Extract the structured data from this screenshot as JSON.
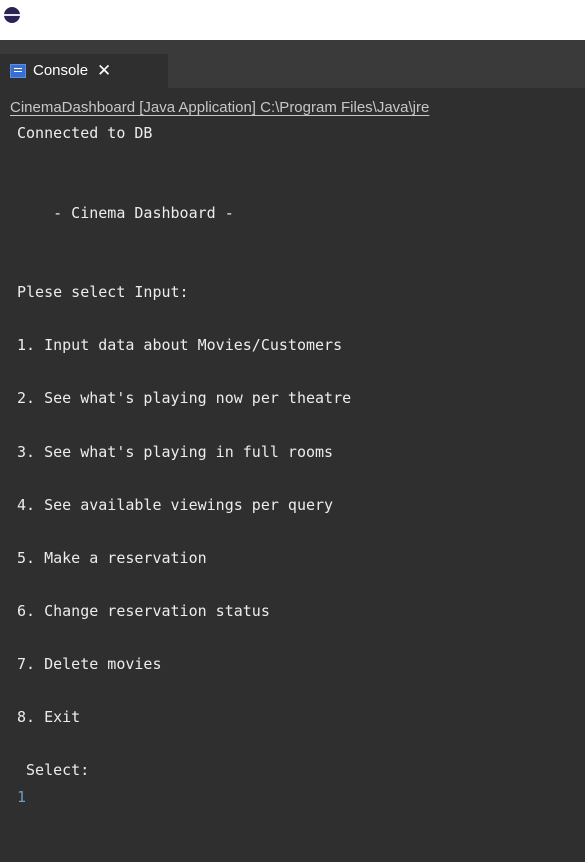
{
  "window": {
    "icon": "eclipse-icon"
  },
  "tab": {
    "icon": "console-icon",
    "label": "Console",
    "close_label": "✕"
  },
  "launch_info": "CinemaDashboard [Java Application] C:\\Program Files\\Java\\jre",
  "console": {
    "lines": [
      {
        "text": "Connected to DB",
        "kind": "output"
      },
      {
        "text": "",
        "kind": "output"
      },
      {
        "text": "",
        "kind": "output"
      },
      {
        "text": "    - Cinema Dashboard -",
        "kind": "output"
      },
      {
        "text": "",
        "kind": "output"
      },
      {
        "text": "",
        "kind": "output"
      },
      {
        "text": "Plese select Input:",
        "kind": "output"
      },
      {
        "text": "",
        "kind": "output"
      },
      {
        "text": "1. Input data about Movies/Customers",
        "kind": "output"
      },
      {
        "text": "",
        "kind": "output"
      },
      {
        "text": "2. See what's playing now per theatre",
        "kind": "output"
      },
      {
        "text": "",
        "kind": "output"
      },
      {
        "text": "3. See what's playing in full rooms",
        "kind": "output"
      },
      {
        "text": "",
        "kind": "output"
      },
      {
        "text": "4. See available viewings per query",
        "kind": "output"
      },
      {
        "text": "",
        "kind": "output"
      },
      {
        "text": "5. Make a reservation",
        "kind": "output"
      },
      {
        "text": "",
        "kind": "output"
      },
      {
        "text": "6. Change reservation status",
        "kind": "output"
      },
      {
        "text": "",
        "kind": "output"
      },
      {
        "text": "7. Delete movies",
        "kind": "output"
      },
      {
        "text": "",
        "kind": "output"
      },
      {
        "text": "8. Exit",
        "kind": "output"
      },
      {
        "text": "",
        "kind": "output"
      },
      {
        "text": " Select:",
        "kind": "output"
      },
      {
        "text": "1",
        "kind": "user-input"
      }
    ]
  },
  "colors": {
    "console_background": "#2f2f2f",
    "output_text": "#ececec",
    "user_input_text": "#6a9ec7"
  }
}
